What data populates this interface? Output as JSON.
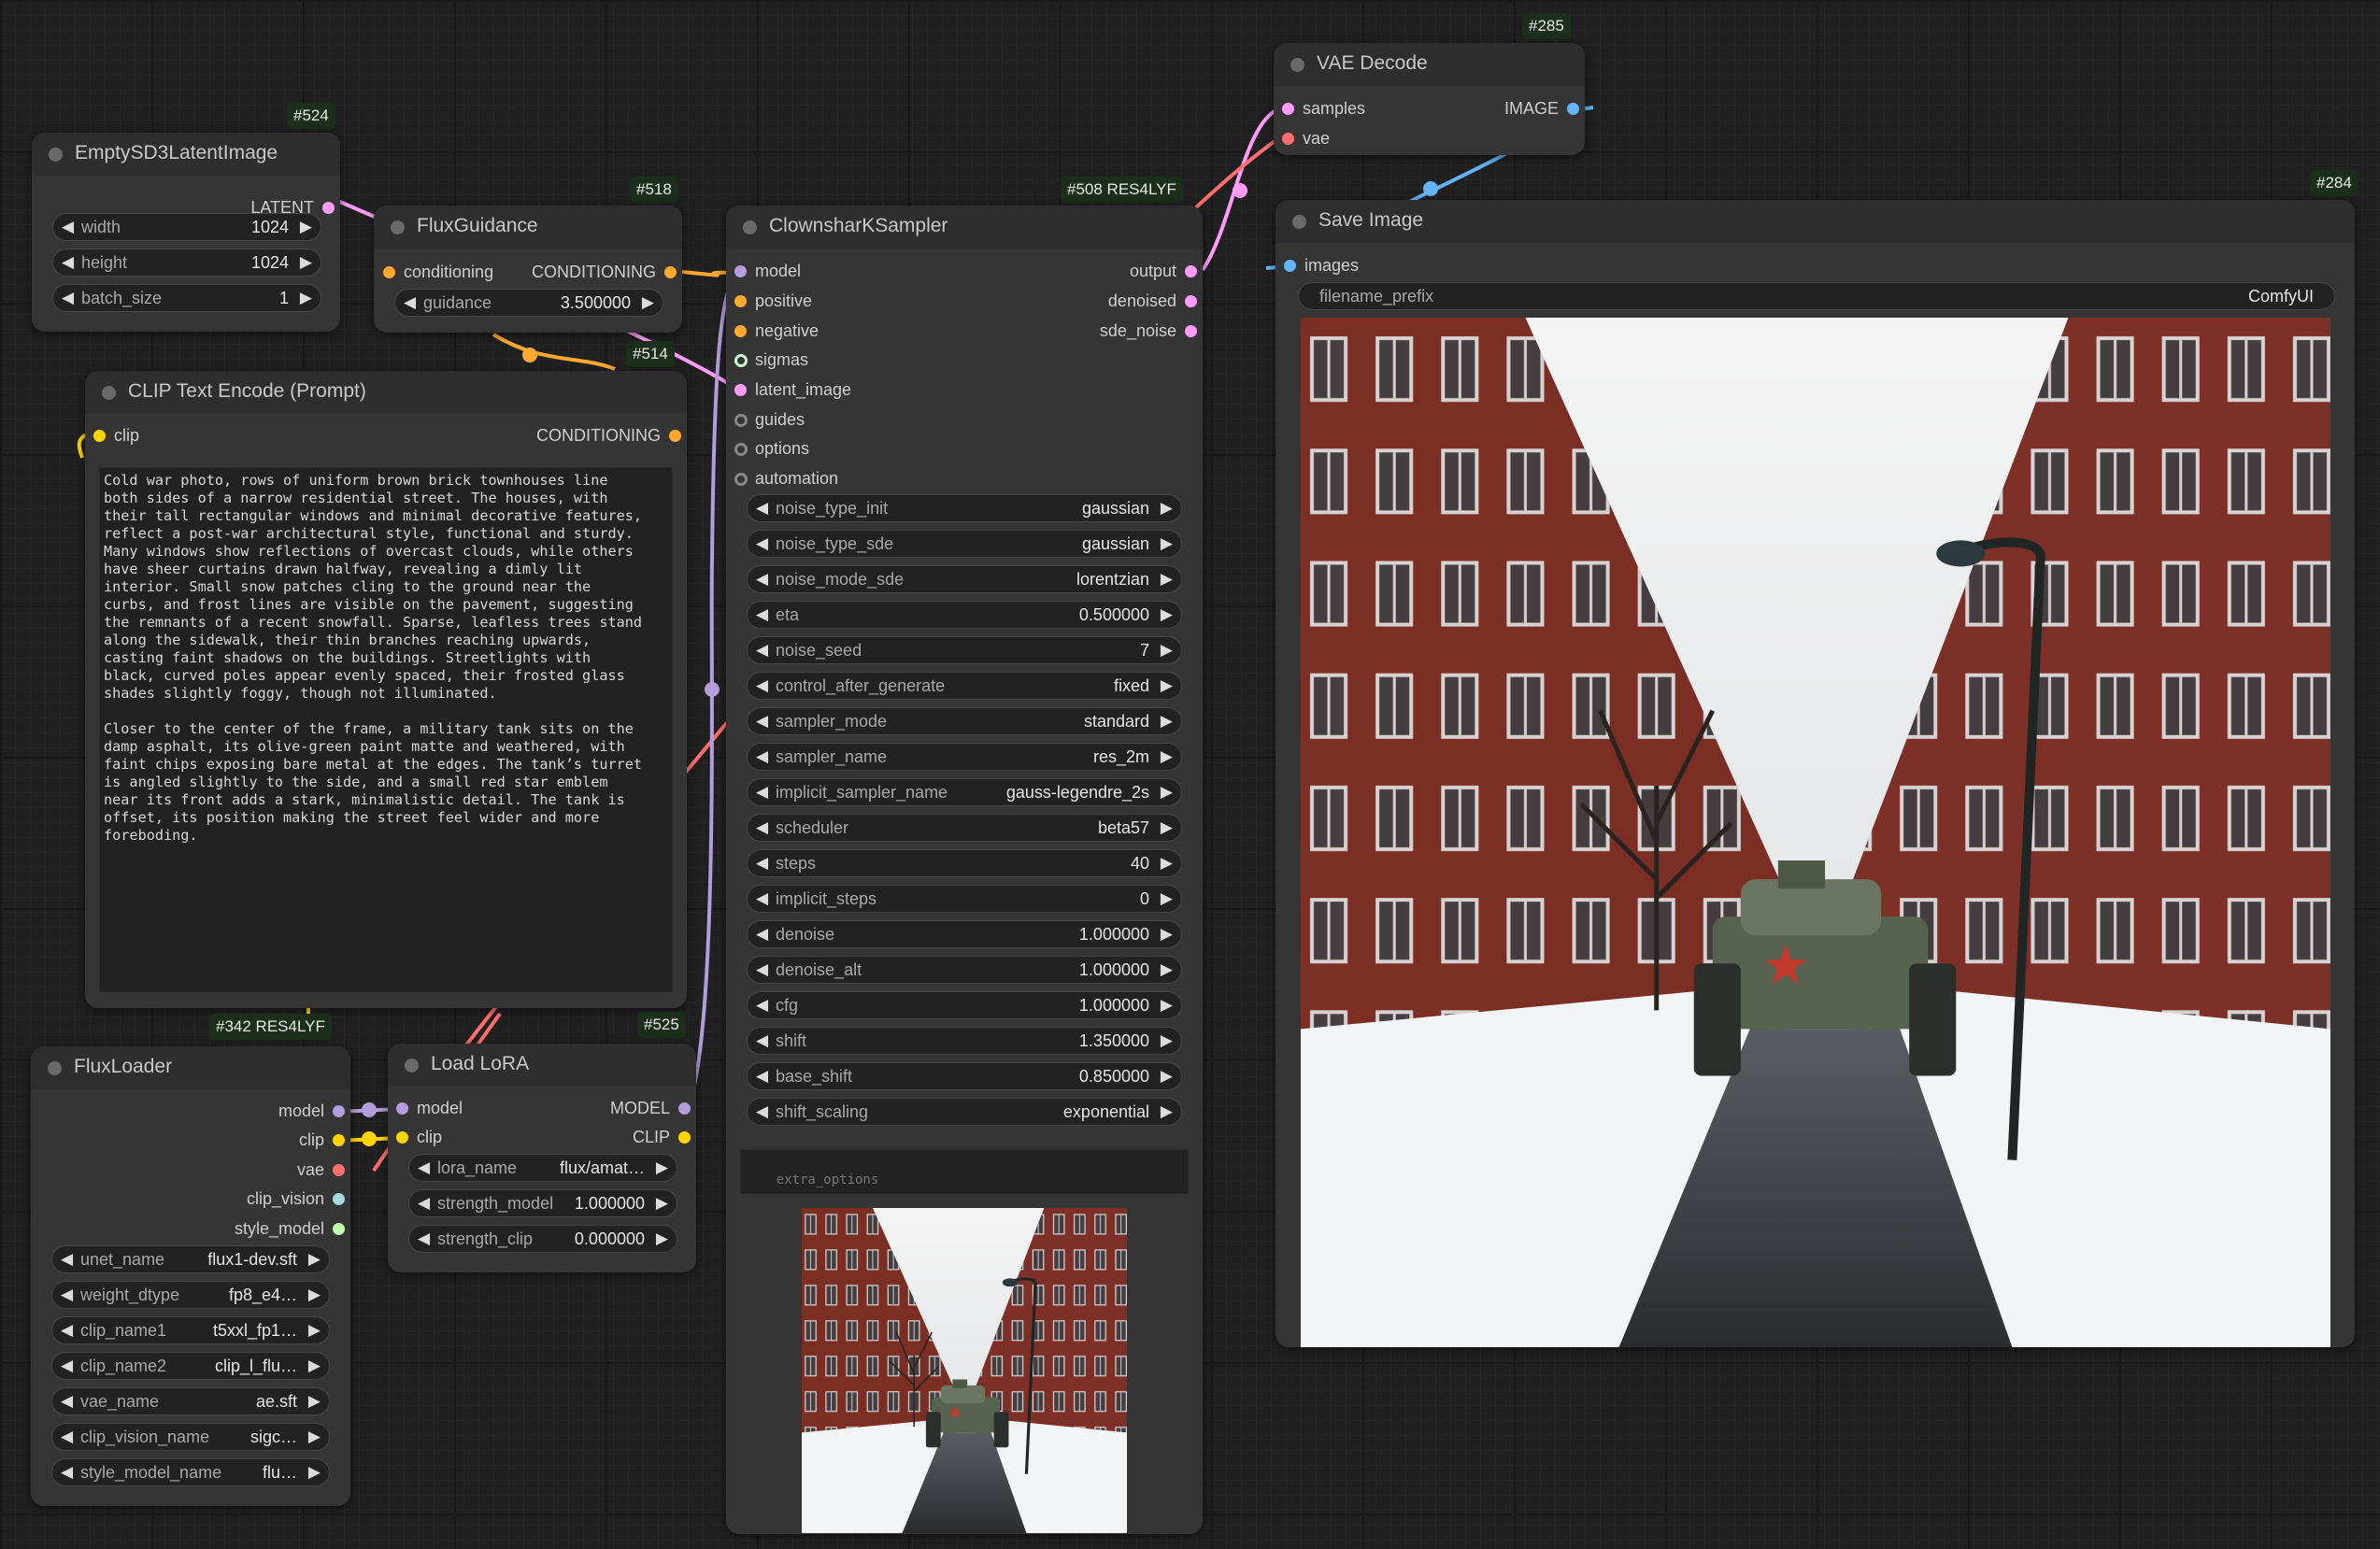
{
  "colors": {
    "model": "#b39ddb",
    "clip": "#ffd500",
    "vae": "#ff6e6e",
    "conditioning": "#ffa931",
    "latent": "#ff9cf9",
    "image": "#64b5f6",
    "clip_vision": "#a8dadc",
    "style_model": "#c2ffae",
    "sigmas": "#cdffcd",
    "generic": "#888888",
    "node_bg": "#353535",
    "canvas_bg": "#202020",
    "id_badge_bg": "#1c2f1c"
  },
  "nodes": {
    "empty_latent": {
      "id": "#524",
      "title": "EmptySD3LatentImage",
      "outputs": [
        "LATENT"
      ],
      "widgets": [
        {
          "name": "width",
          "value": "1024"
        },
        {
          "name": "height",
          "value": "1024"
        },
        {
          "name": "batch_size",
          "value": "1"
        }
      ]
    },
    "flux_guidance": {
      "id": "#518",
      "title": "FluxGuidance",
      "inputs": [
        "conditioning"
      ],
      "outputs": [
        "CONDITIONING"
      ],
      "widgets": [
        {
          "name": "guidance",
          "value": "3.500000"
        }
      ]
    },
    "clip_text": {
      "id": "#514",
      "title": "CLIP Text Encode (Prompt)",
      "inputs": [
        "clip"
      ],
      "outputs": [
        "CONDITIONING"
      ],
      "text": "Cold war photo, rows of uniform brown brick townhouses line\nboth sides of a narrow residential street. The houses, with\ntheir tall rectangular windows and minimal decorative features,\nreflect a post-war architectural style, functional and sturdy.\nMany windows show reflections of overcast clouds, while others\nhave sheer curtains drawn halfway, revealing a dimly lit\ninterior. Small snow patches cling to the ground near the\ncurbs, and frost lines are visible on the pavement, suggesting\nthe remnants of a recent snowfall. Sparse, leafless trees stand\nalong the sidewalk, their thin branches reaching upwards,\ncasting faint shadows on the buildings. Streetlights with\nblack, curved poles appear evenly spaced, their frosted glass\nshades slightly foggy, though not illuminated.\n\nCloser to the center of the frame, a military tank sits on the\ndamp asphalt, its olive-green paint matte and weathered, with\nfaint chips exposing bare metal at the edges. The tank’s turret\nis angled slightly to the side, and a small red star emblem\nnear its front adds a stark, minimalistic detail. The tank is\noffset, its position making the street feel wider and more\nforeboding."
    },
    "sampler": {
      "id": "#508 RES4LYF",
      "title": "ClownsharKSampler",
      "inputs": [
        "model",
        "positive",
        "negative",
        "sigmas",
        "latent_image",
        "guides",
        "options",
        "automation"
      ],
      "outputs": [
        "output",
        "denoised",
        "sde_noise"
      ],
      "widgets": [
        {
          "name": "noise_type_init",
          "value": "gaussian"
        },
        {
          "name": "noise_type_sde",
          "value": "gaussian"
        },
        {
          "name": "noise_mode_sde",
          "value": "lorentzian"
        },
        {
          "name": "eta",
          "value": "0.500000"
        },
        {
          "name": "noise_seed",
          "value": "7"
        },
        {
          "name": "control_after_generate",
          "value": "fixed"
        },
        {
          "name": "sampler_mode",
          "value": "standard"
        },
        {
          "name": "sampler_name",
          "value": "res_2m"
        },
        {
          "name": "implicit_sampler_name",
          "value": "gauss-legendre_2s"
        },
        {
          "name": "scheduler",
          "value": "beta57"
        },
        {
          "name": "steps",
          "value": "40"
        },
        {
          "name": "implicit_steps",
          "value": "0"
        },
        {
          "name": "denoise",
          "value": "1.000000"
        },
        {
          "name": "denoise_alt",
          "value": "1.000000"
        },
        {
          "name": "cfg",
          "value": "1.000000"
        },
        {
          "name": "shift",
          "value": "1.350000"
        },
        {
          "name": "base_shift",
          "value": "0.850000"
        },
        {
          "name": "shift_scaling",
          "value": "exponential"
        }
      ],
      "extra_placeholder": "extra_options"
    },
    "vae_decode": {
      "id": "#285",
      "title": "VAE Decode",
      "inputs": [
        "samples",
        "vae"
      ],
      "outputs": [
        "IMAGE"
      ]
    },
    "save_image": {
      "id": "#284",
      "title": "Save Image",
      "inputs": [
        "images"
      ],
      "widgets": [
        {
          "name": "filename_prefix",
          "value": "ComfyUI"
        }
      ]
    },
    "flux_loader": {
      "id": "#342 RES4LYF",
      "title": "FluxLoader",
      "outputs": [
        "model",
        "clip",
        "vae",
        "clip_vision",
        "style_model"
      ],
      "widgets": [
        {
          "name": "unet_name",
          "value": "flux1-dev.sft"
        },
        {
          "name": "weight_dtype",
          "value": "fp8_e4…"
        },
        {
          "name": "clip_name1",
          "value": "t5xxl_fp1…"
        },
        {
          "name": "clip_name2",
          "value": "clip_l_flu…"
        },
        {
          "name": "vae_name",
          "value": "ae.sft"
        },
        {
          "name": "clip_vision_name",
          "value": "sigc…"
        },
        {
          "name": "style_model_name",
          "value": "flu…"
        }
      ]
    },
    "load_lora": {
      "id": "#525",
      "title": "Load LoRA",
      "inputs": [
        "model",
        "clip"
      ],
      "outputs": [
        "MODEL",
        "CLIP"
      ],
      "widgets": [
        {
          "name": "lora_name",
          "value": "flux/amat…"
        },
        {
          "name": "strength_model",
          "value": "1.000000"
        },
        {
          "name": "strength_clip",
          "value": "0.000000"
        }
      ]
    }
  }
}
